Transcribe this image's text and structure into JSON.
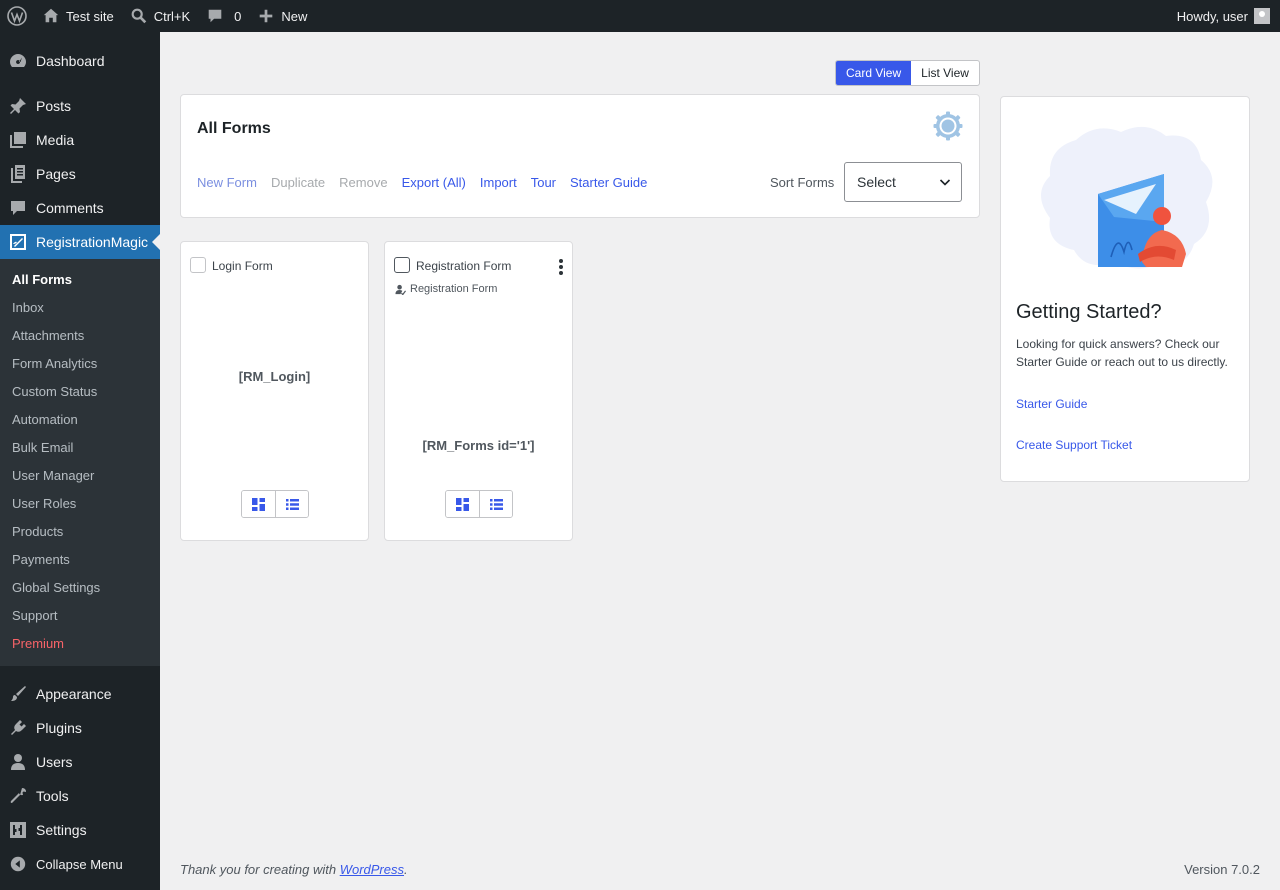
{
  "adminbar": {
    "site_name": "Test site",
    "search_shortcut": "Ctrl+K",
    "comments_count": "0",
    "new_label": "New",
    "howdy": "Howdy, user"
  },
  "menu": {
    "dashboard": "Dashboard",
    "posts": "Posts",
    "media": "Media",
    "pages": "Pages",
    "comments": "Comments",
    "registrationmagic": "RegistrationMagic",
    "submenu": [
      "All Forms",
      "Inbox",
      "Attachments",
      "Form Analytics",
      "Custom Status",
      "Automation",
      "Bulk Email",
      "User Manager",
      "User Roles",
      "Products",
      "Payments",
      "Global Settings",
      "Support",
      "Premium"
    ],
    "appearance": "Appearance",
    "plugins": "Plugins",
    "users": "Users",
    "tools": "Tools",
    "settings": "Settings",
    "collapse": "Collapse Menu"
  },
  "view_toggle": {
    "card_view": "Card View",
    "list_view": "List View",
    "active": "Card View"
  },
  "panel": {
    "title": "All Forms",
    "actions": [
      "New Form",
      "Duplicate",
      "Remove",
      "Export (All)",
      "Import",
      "Tour",
      "Starter Guide"
    ],
    "sort_label": "Sort Forms",
    "sort_value": "Select"
  },
  "cards": [
    {
      "name": "Login Form",
      "subtitle": "",
      "shortcode": "[RM_Login]"
    },
    {
      "name": "Registration Form",
      "subtitle": "Registration Form",
      "shortcode": "[RM_Forms id='1']"
    }
  ],
  "getting_started": {
    "title": "Getting Started?",
    "text": "Looking for quick answers? Check our Starter Guide or reach out to us directly.",
    "link_guide": "Starter Guide",
    "link_ticket": "Create Support Ticket"
  },
  "footer": {
    "thanks_prefix": "Thank you for creating with ",
    "thanks_link": "WordPress",
    "thanks_suffix": ".",
    "version": "Version 7.0.2"
  },
  "colors": {
    "accent": "#3858e9",
    "admin_dark": "#1d2327",
    "current_menu": "#2271b1",
    "premium": "#f86368"
  }
}
